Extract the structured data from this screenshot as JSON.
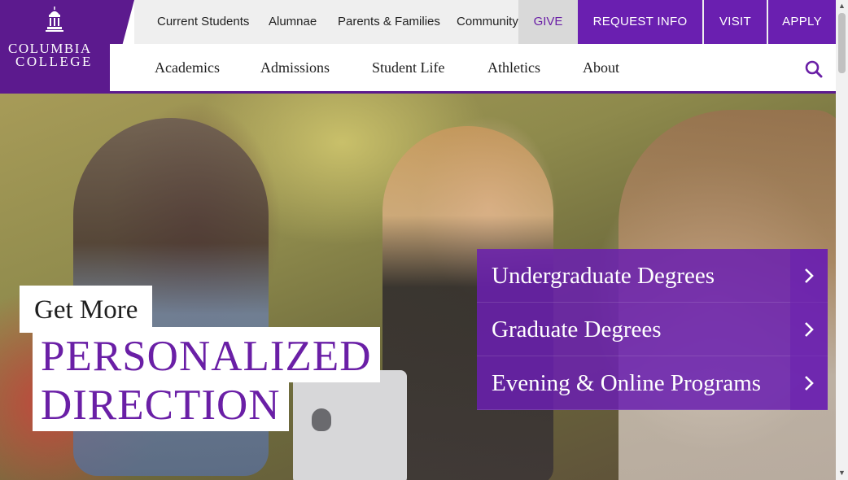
{
  "logo": {
    "line1": "COLUMBIA",
    "line2": "COLLEGE",
    "icon": "cupola-icon"
  },
  "utility_nav": {
    "links": [
      "Current Students",
      "Alumnae",
      "Parents & Families",
      "Community"
    ],
    "give": "GIVE",
    "cta": [
      "REQUEST INFO",
      "VISIT",
      "APPLY"
    ]
  },
  "main_nav": {
    "items": [
      "Academics",
      "Admissions",
      "Student Life",
      "Athletics",
      "About"
    ],
    "search_icon": "search-icon"
  },
  "hero": {
    "headline_small": "Get More",
    "headline_line1": "PERSONALIZED",
    "headline_line2": "DIRECTION"
  },
  "degrees": [
    {
      "label": "Undergraduate Degrees",
      "icon": "chevron-right-icon"
    },
    {
      "label": "Graduate Degrees",
      "icon": "chevron-right-icon"
    },
    {
      "label": "Evening & Online Programs",
      "icon": "chevron-right-icon"
    }
  ],
  "colors": {
    "brand_purple": "#5c1a8e",
    "cta_purple": "#6a1fb0",
    "give_text": "#6a1fa6"
  }
}
